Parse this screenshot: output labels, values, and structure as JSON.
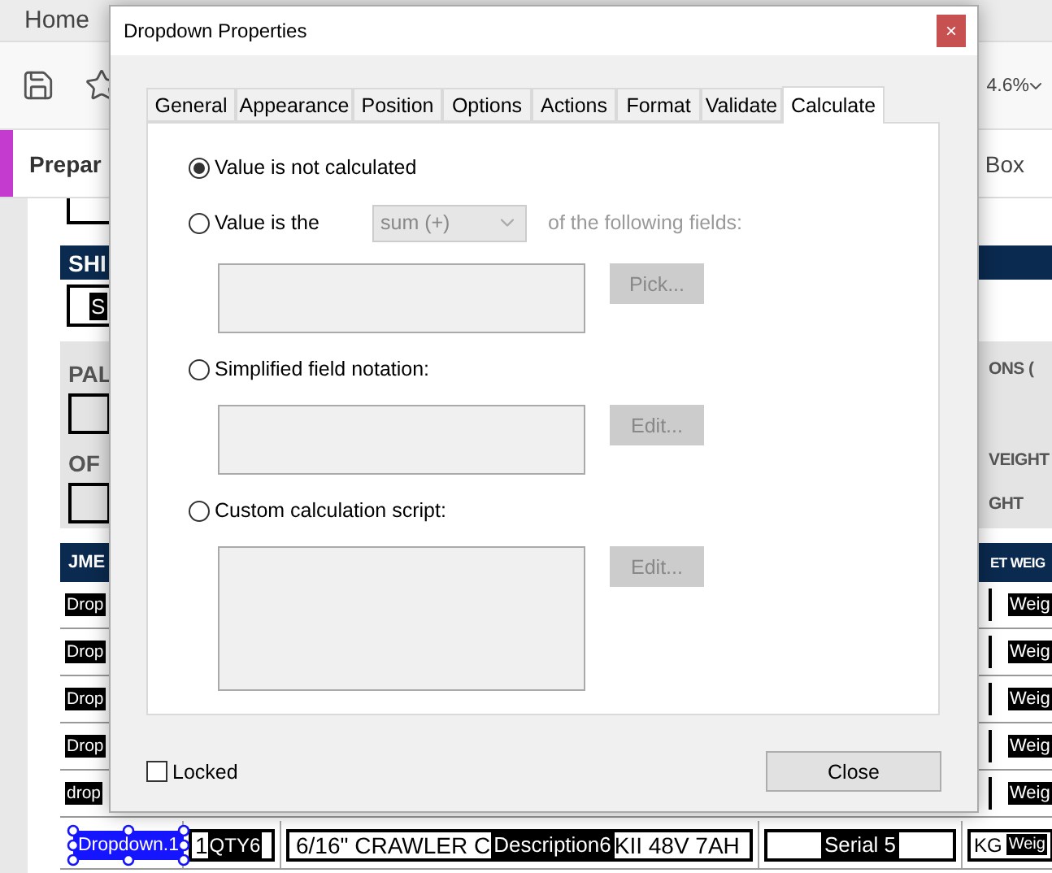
{
  "app": {
    "menu_tab": "Home",
    "zoom": "4.6%",
    "tool_title": "Prepar",
    "tool_right": "Box"
  },
  "form": {
    "section_header": "SHI",
    "ship_field": "S",
    "panel_labels": [
      "PAL",
      "OF"
    ],
    "right_labels": [
      "ONS (",
      "VEIGHT",
      "GHT"
    ],
    "table_header_left": "JME",
    "table_header_right": "ET WEIG",
    "rows": [
      {
        "left": "Drop",
        "right": "Weig"
      },
      {
        "left": "Drop",
        "right": "Weig"
      },
      {
        "left": "Drop",
        "right": "Weig"
      },
      {
        "left": "Drop",
        "right": "Weig"
      },
      {
        "left": "drop",
        "right": "Weig"
      }
    ],
    "selected_row": {
      "dropdown": {
        "value": "Dropdown.1",
        "selected": true
      },
      "qty_value": "1",
      "qty_field": "QTY6",
      "description_before": "6/16\" CRAWLER C",
      "description_field": "Description6",
      "description_after": "KII 48V 7AH",
      "serial_field": "Serial 5",
      "unit": "KG",
      "weight_field": "Weig"
    }
  },
  "dialog": {
    "title": "Dropdown Properties",
    "close": "×",
    "tabs": [
      {
        "label": "General",
        "selected": false
      },
      {
        "label": "Appearance",
        "selected": false
      },
      {
        "label": "Position",
        "selected": false
      },
      {
        "label": "Options",
        "selected": false
      },
      {
        "label": "Actions",
        "selected": false
      },
      {
        "label": "Format",
        "selected": false
      },
      {
        "label": "Validate",
        "selected": false
      },
      {
        "label": "Calculate",
        "selected": true
      }
    ],
    "options": [
      {
        "kind": "plain",
        "label": "Value is not calculated",
        "selected": true
      },
      {
        "kind": "fields",
        "label": "Value is the",
        "selected": false,
        "operation": "sum (+)",
        "suffix": "of the following fields:",
        "button": "Pick...",
        "disabled": true
      },
      {
        "kind": "notation",
        "label": "Simplified field notation:",
        "selected": false,
        "button": "Edit...",
        "disabled": true
      },
      {
        "kind": "script",
        "label": "Custom calculation script:",
        "selected": false,
        "button": "Edit...",
        "disabled": true
      }
    ],
    "locked": {
      "label": "Locked",
      "checked": false
    },
    "close_button": "Close"
  }
}
